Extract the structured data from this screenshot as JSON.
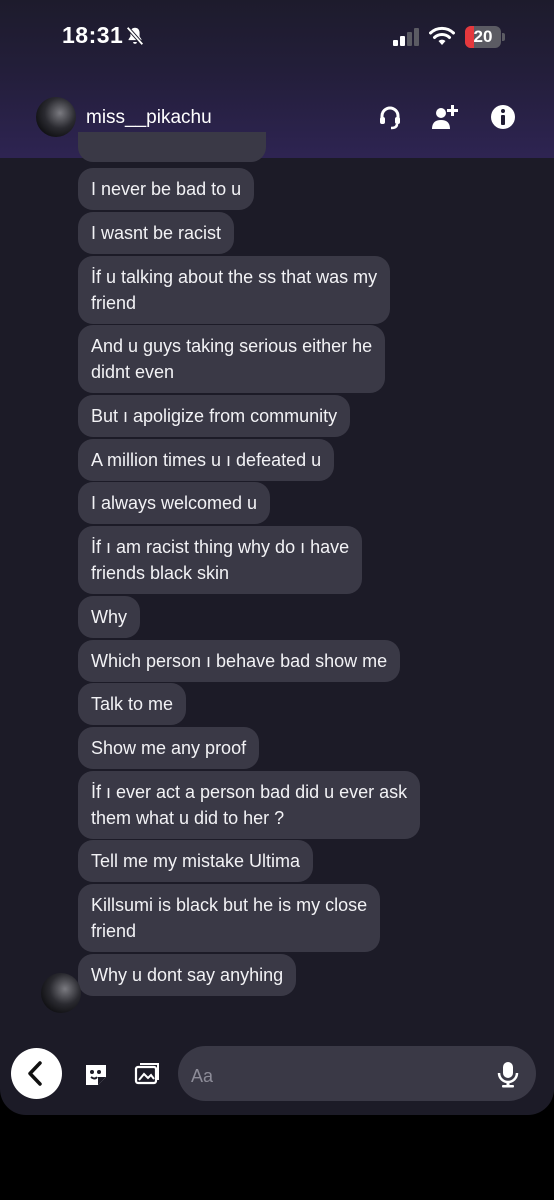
{
  "status_bar": {
    "time": "18:31",
    "battery_level": "20"
  },
  "header": {
    "username": "miss__pikachu"
  },
  "messages": [
    {
      "text": "I never be bad to u"
    },
    {
      "text": "I wasnt be racist"
    },
    {
      "line1": "İf u talking about the ss that was my",
      "line2": "friend"
    },
    {
      "line1": "And u guys taking serious either he",
      "line2": "didnt even"
    },
    {
      "text": "But ı apoligize from community"
    },
    {
      "text": "A million times u ı defeated u"
    },
    {
      "text": "I always welcomed u"
    },
    {
      "line1": "İf ı am racist thing why do ı have",
      "line2": "friends black skin"
    },
    {
      "text": "Why"
    },
    {
      "text": "Which person ı behave bad show me"
    },
    {
      "text": "Talk to me"
    },
    {
      "text": "Show me any proof"
    },
    {
      "line1": "İf ı ever act a person bad did u ever ask",
      "line2": "them what u did to her ?"
    },
    {
      "text": "Tell me my mistake Ultima"
    },
    {
      "line1": "Killsumi is black but he is my close",
      "line2": "friend"
    },
    {
      "text": "Why u dont say anyhing"
    }
  ],
  "composer": {
    "placeholder": "Aa"
  },
  "colors": {
    "bubble": "#3a3946",
    "background": "#1c1b27",
    "header_gradient_end": "#2e2452",
    "battery_low": "#e5383d"
  },
  "icons": [
    "bell-slash-icon",
    "signal-icon",
    "wifi-icon",
    "battery-icon",
    "headset-icon",
    "add-user-icon",
    "info-icon",
    "back-chevron-icon",
    "sticker-icon",
    "gallery-icon",
    "microphone-icon"
  ]
}
